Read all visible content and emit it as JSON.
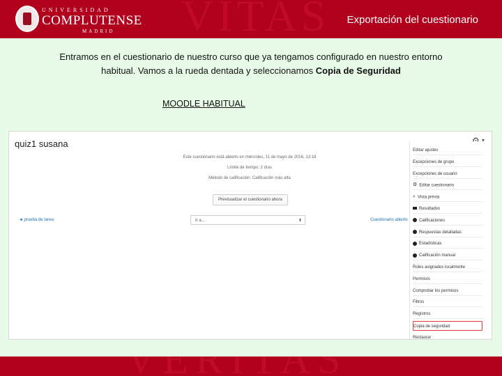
{
  "header": {
    "logo_top": "UNIVERSIDAD",
    "logo_main": "COMPLUTENSE",
    "logo_bottom": "MADRID",
    "title": "Exportación del cuestionario"
  },
  "intro": {
    "text_before": "Entramos en el cuestionario de nuestro curso que ya tengamos configurado en nuestro entorno habitual. Vamos a la rueda dentada y seleccionamos ",
    "bold": "Copia de Seguridad"
  },
  "subtitle": "MOODLE HABITUAL",
  "screenshot": {
    "quiz_title": "quiz1 susana",
    "info_line1": "Este cuestionario está abierto en miércoles, 11 de mayo de 2016, 13:18",
    "info_line2": "Límite de tiempo: 2 días",
    "info_line3": "Método de calificación: Calificación más alta",
    "preview_button": "Previsualizar el cuestionario ahora",
    "prev_link": "◄ prueba de tarea",
    "jump_select": "Ir a...",
    "next_link": "Cuestionario abierto",
    "menu": [
      {
        "label": "Editar ajustes",
        "icon": "none",
        "highlight": false
      },
      {
        "label": "Excepciones de grupo",
        "icon": "none",
        "highlight": false
      },
      {
        "label": "Excepciones de usuario",
        "icon": "none",
        "highlight": false
      },
      {
        "label": "Editar cuestionario",
        "icon": "gear-icon",
        "highlight": false
      },
      {
        "label": "Vista previa",
        "icon": "search-icon",
        "highlight": false
      },
      {
        "label": "Resultados",
        "icon": "chart-icon",
        "highlight": false
      },
      {
        "label": "Calificaciones",
        "icon": "bullet-icon",
        "highlight": false
      },
      {
        "label": "Respuestas detalladas",
        "icon": "bullet-icon",
        "highlight": false
      },
      {
        "label": "Estadísticas",
        "icon": "bullet-icon",
        "highlight": false
      },
      {
        "label": "Calificación manual",
        "icon": "bullet-icon",
        "highlight": false
      },
      {
        "label": "Roles asignados localmente",
        "icon": "none",
        "highlight": false
      },
      {
        "label": "Permisos",
        "icon": "none",
        "highlight": false
      },
      {
        "label": "Comprobar los permisos",
        "icon": "none",
        "highlight": false
      },
      {
        "label": "Filtros",
        "icon": "none",
        "highlight": false
      },
      {
        "label": "Registros",
        "icon": "none",
        "highlight": false
      },
      {
        "label": "Copia de seguridad",
        "icon": "none",
        "highlight": true
      },
      {
        "label": "Restaurar",
        "icon": "none",
        "highlight": false
      }
    ]
  },
  "colors": {
    "brand": "#b0001c",
    "background": "#e8fae8",
    "highlight_border": "#e03a3a"
  }
}
